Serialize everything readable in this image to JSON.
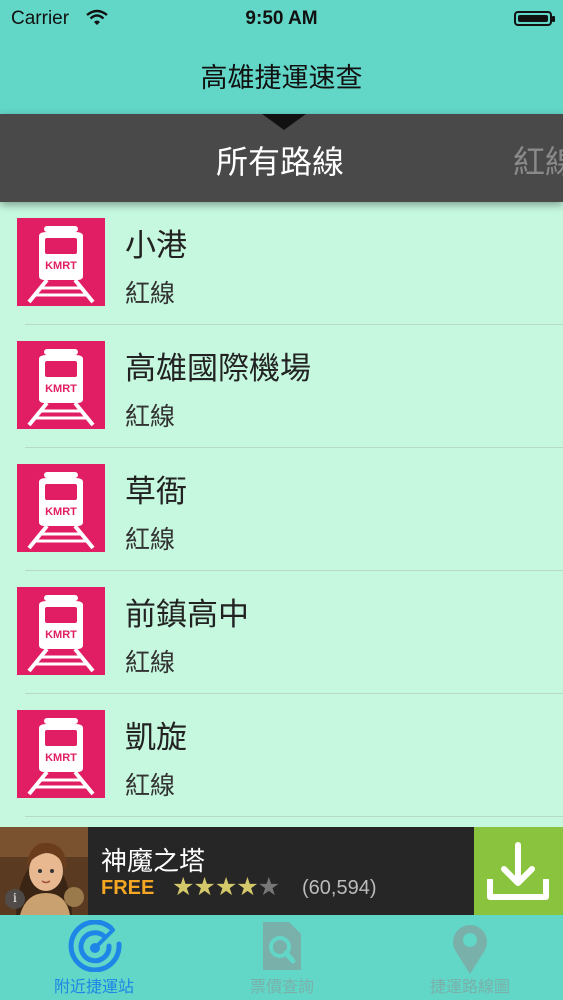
{
  "status_bar": {
    "carrier": "Carrier",
    "time": "9:50 AM"
  },
  "navbar": {
    "title": "高雄捷運速查"
  },
  "line_tabs": {
    "active": "所有路線",
    "next": "紅線"
  },
  "stations": [
    {
      "name": "小港",
      "line": "紅線",
      "icon": "kmrt-train-icon"
    },
    {
      "name": "高雄國際機場",
      "line": "紅線",
      "icon": "kmrt-train-icon"
    },
    {
      "name": "草衙",
      "line": "紅線",
      "icon": "kmrt-train-icon"
    },
    {
      "name": "前鎮高中",
      "line": "紅線",
      "icon": "kmrt-train-icon"
    },
    {
      "name": "凱旋",
      "line": "紅線",
      "icon": "kmrt-train-icon"
    }
  ],
  "kmrt_label": "KMRT",
  "ad": {
    "app_name": "神魔之塔",
    "price": "FREE",
    "rating_count": "(60,594)",
    "rating": 4.5,
    "info": "i"
  },
  "tab_bar": {
    "items": [
      {
        "label": "附近捷運站",
        "icon": "radar-icon",
        "active": true
      },
      {
        "label": "票價查詢",
        "icon": "fare-search-icon",
        "active": false
      },
      {
        "label": "捷運路線圖",
        "icon": "map-pin-icon",
        "active": false
      }
    ]
  },
  "colors": {
    "teal": "#62d6c7",
    "mint": "#c6f8df",
    "kmrt_red": "#e11e63",
    "dark_tab": "#4a4949",
    "ad_green": "#8ac43f",
    "active_blue": "#1d86e6"
  }
}
